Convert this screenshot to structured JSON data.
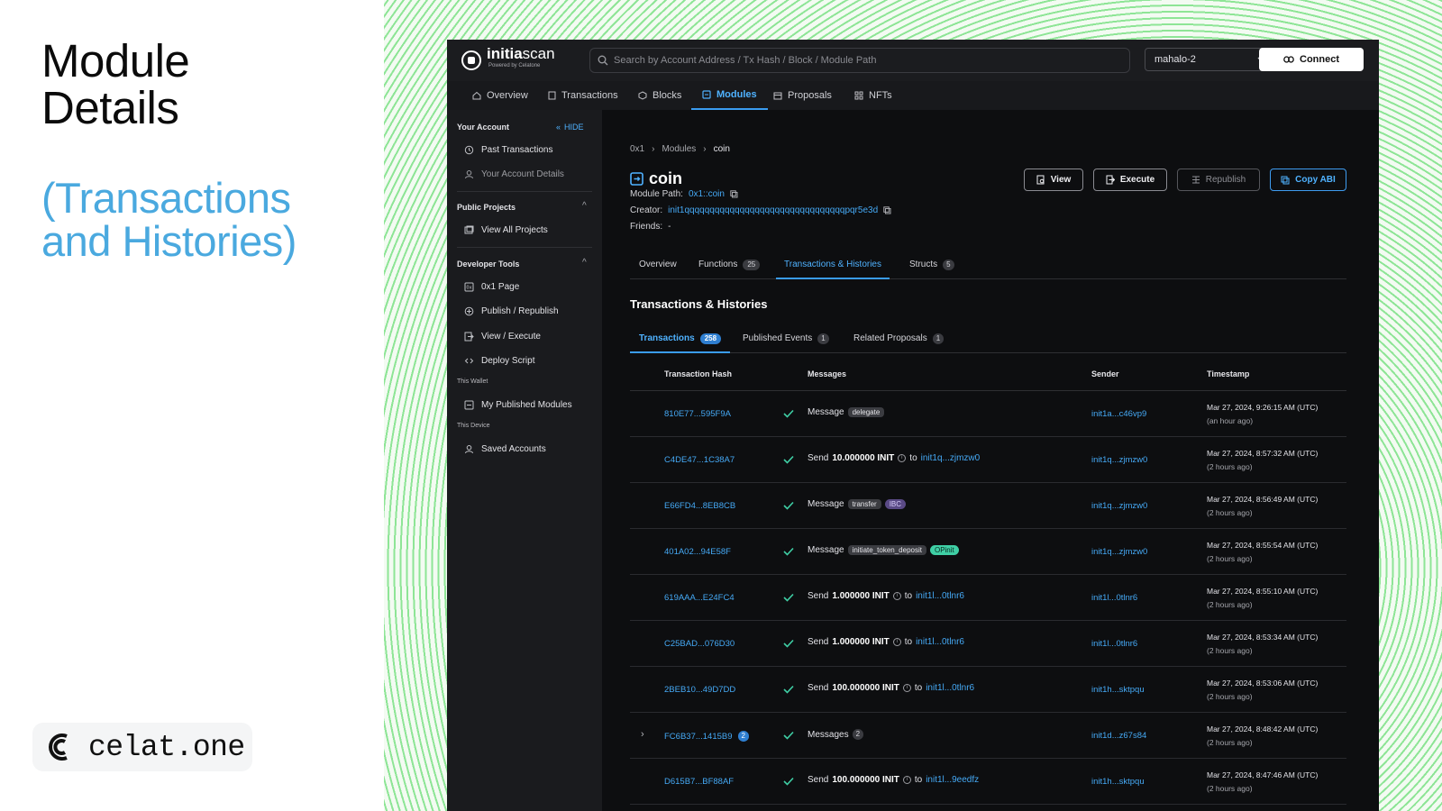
{
  "presentation": {
    "title_line1": "Module",
    "title_line2": "Details",
    "subtitle_line1": "(Transactions",
    "subtitle_line2": "and Histories)",
    "brand": "celat.one"
  },
  "colors": {
    "accent": "#4fb2ff",
    "brand_blue": "#4aa9df",
    "success": "#3fcfa5",
    "ibc_tag": "#5a4a86"
  },
  "header": {
    "logo_bold": "initia",
    "logo_light": "scan",
    "logo_tagline": "Powered by Celatone",
    "search_placeholder": "Search by Account Address / Tx Hash / Block / Module Path",
    "network": "mahalo-2",
    "connect_label": "Connect"
  },
  "nav": {
    "items": [
      {
        "label": "Overview",
        "icon": "home-icon"
      },
      {
        "label": "Transactions",
        "icon": "document-icon"
      },
      {
        "label": "Blocks",
        "icon": "cube-icon"
      },
      {
        "label": "Modules",
        "icon": "module-icon"
      },
      {
        "label": "Proposals",
        "icon": "proposal-icon"
      },
      {
        "label": "NFTs",
        "icon": "grid-icon"
      }
    ],
    "active": "Modules"
  },
  "sidebar": {
    "your_account": "Your Account",
    "hide": "HIDE",
    "past_transactions": "Past Transactions",
    "account_details": "Your Account Details",
    "public_projects": "Public Projects",
    "view_all_projects": "View All Projects",
    "developer_tools": "Developer Tools",
    "page_0x1": "0x1 Page",
    "publish": "Publish / Republish",
    "view_execute": "View / Execute",
    "deploy_script": "Deploy Script",
    "this_wallet": "This Wallet",
    "my_published_modules": "My Published Modules",
    "this_device": "This Device",
    "saved_accounts": "Saved Accounts"
  },
  "breadcrumb": {
    "root": "0x1",
    "section": "Modules",
    "current": "coin"
  },
  "module": {
    "name": "coin",
    "path_label": "Module Path:",
    "path": "0x1::coin",
    "creator_label": "Creator:",
    "creator": "init1qqqqqqqqqqqqqqqqqqqqqqqqqqqqqqqqpqr5e3d",
    "friends_label": "Friends:",
    "friends": "-"
  },
  "actions": {
    "view": "View",
    "execute": "Execute",
    "republish": "Republish",
    "copy_abi": "Copy ABI"
  },
  "tabs": {
    "overview": "Overview",
    "functions": "Functions",
    "functions_count": "25",
    "tx_histories": "Transactions & Histories",
    "structs": "Structs",
    "structs_count": "5"
  },
  "section": {
    "title": "Transactions & Histories",
    "tab_transactions": "Transactions",
    "tab_transactions_count": "258",
    "tab_events": "Published Events",
    "tab_events_count": "1",
    "tab_proposals": "Related Proposals",
    "tab_proposals_count": "1"
  },
  "table": {
    "headers": {
      "hash": "Transaction Hash",
      "messages": "Messages",
      "sender": "Sender",
      "timestamp": "Timestamp"
    },
    "rows": [
      {
        "hash": "810E77...595F9A",
        "msg_prefix": "Message",
        "tag1": "delegate",
        "sender": "init1a...c46vp9",
        "time": "Mar 27, 2024, 9:26:15 AM (UTC)",
        "ago": "(an hour ago)"
      },
      {
        "hash": "C4DE47...1C38A7",
        "msg_prefix": "Send",
        "amount": "10.000000 INIT",
        "to": "to",
        "recipient": "init1q...zjmzw0",
        "sender": "init1q...zjmzw0",
        "time": "Mar 27, 2024, 8:57:32 AM (UTC)",
        "ago": "(2 hours ago)"
      },
      {
        "hash": "E66FD4...8EB8CB",
        "msg_prefix": "Message",
        "tag1": "transfer",
        "tag2": "IBC",
        "sender": "init1q...zjmzw0",
        "time": "Mar 27, 2024, 8:56:49 AM (UTC)",
        "ago": "(2 hours ago)"
      },
      {
        "hash": "401A02...94E58F",
        "msg_prefix": "Message",
        "tag1": "initiate_token_deposit",
        "tag2": "OPinit",
        "sender": "init1q...zjmzw0",
        "time": "Mar 27, 2024, 8:55:54 AM (UTC)",
        "ago": "(2 hours ago)"
      },
      {
        "hash": "619AAA...E24FC4",
        "msg_prefix": "Send",
        "amount": "1.000000 INIT",
        "to": "to",
        "recipient": "init1l...0tlnr6",
        "sender": "init1l...0tlnr6",
        "time": "Mar 27, 2024, 8:55:10 AM (UTC)",
        "ago": "(2 hours ago)"
      },
      {
        "hash": "C25BAD...076D30",
        "msg_prefix": "Send",
        "amount": "1.000000 INIT",
        "to": "to",
        "recipient": "init1l...0tlnr6",
        "sender": "init1l...0tlnr6",
        "time": "Mar 27, 2024, 8:53:34 AM (UTC)",
        "ago": "(2 hours ago)"
      },
      {
        "hash": "2BEB10...49D7DD",
        "msg_prefix": "Send",
        "amount": "100.000000 INIT",
        "to": "to",
        "recipient": "init1l...0tlnr6",
        "sender": "init1h...sktpqu",
        "time": "Mar 27, 2024, 8:53:06 AM (UTC)",
        "ago": "(2 hours ago)"
      },
      {
        "hash": "FC6B37...1415B9",
        "hash_badge": "2",
        "msg_prefix": "Messages",
        "msg_count": "2",
        "sender": "init1d...z67s84",
        "time": "Mar 27, 2024, 8:48:42 AM (UTC)",
        "ago": "(2 hours ago)"
      },
      {
        "hash": "D615B7...BF88AF",
        "msg_prefix": "Send",
        "amount": "100.000000 INIT",
        "to": "to",
        "recipient": "init1l...9eedfz",
        "sender": "init1h...sktpqu",
        "time": "Mar 27, 2024, 8:47:46 AM (UTC)",
        "ago": "(2 hours ago)"
      }
    ]
  }
}
